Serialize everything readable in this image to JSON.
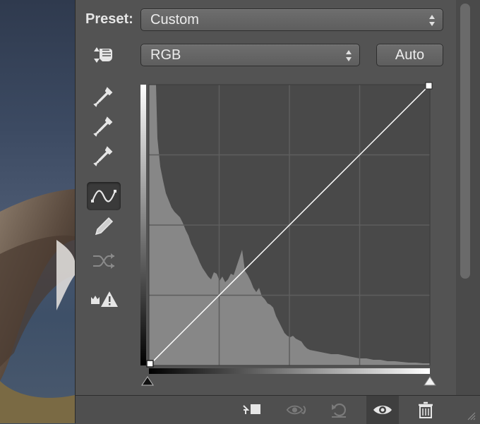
{
  "properties_panel": {
    "preset_label": "Preset:",
    "preset_value": "Custom",
    "channel_value": "RGB",
    "auto_label": "Auto"
  },
  "tools": [
    {
      "name": "on-image-adjust-hand-icon",
      "active": false
    },
    {
      "name": "sample-black-point-eyedropper-icon",
      "active": false
    },
    {
      "name": "sample-gray-point-eyedropper-icon",
      "active": false
    },
    {
      "name": "sample-white-point-eyedropper-icon",
      "active": false
    },
    {
      "name": "curve-points-icon",
      "active": true
    },
    {
      "name": "pencil-draw-icon",
      "active": false
    },
    {
      "name": "smooth-curve-icon",
      "active": false
    },
    {
      "name": "clipping-warning-icon",
      "active": false
    }
  ],
  "curve": {
    "input_range": [
      0,
      255
    ],
    "output_range": [
      0,
      255
    ],
    "points": [
      [
        0,
        0
      ],
      [
        255,
        255
      ]
    ],
    "grid": "4x4"
  },
  "bottom_bar": {
    "icons": [
      "clip-to-layer-icon",
      "view-previous-state-icon",
      "reset-icon",
      "visibility-eye-icon",
      "trash-icon"
    ]
  },
  "colors": {
    "panel_bg": "#535353",
    "graph_bg": "#494949",
    "histogram": "#878787",
    "curve": "#ffffff"
  }
}
